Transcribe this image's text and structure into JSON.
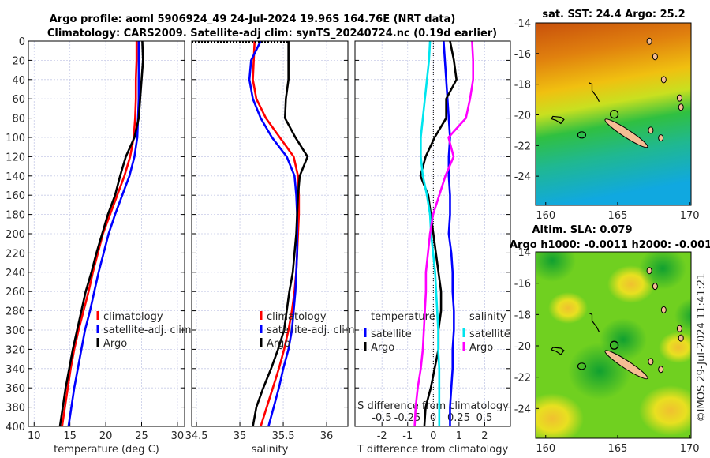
{
  "title_line1": "Argo profile: aoml 5906924_49 24-Jul-2024 19.96S 164.76E (NRT data)",
  "title_line2": "Climatology: CARS2009. Satellite-adj clim: synTS_20240724.nc (0.19d earlier)",
  "watermark": "©IMOS 29-Jul-2024 11:41:21",
  "colors": {
    "climatology": "#ff0000",
    "satellite": "#0000ff",
    "argo": "#000000",
    "sat_salinity": "#00e5ee",
    "argo_salinity": "#ff00ff",
    "land": "#f5bd94"
  },
  "chart_data": [
    {
      "type": "line",
      "xlabel": "temperature (deg C)",
      "ylabel": "",
      "xlim": [
        9.2,
        31.0
      ],
      "ylim": [
        400,
        0
      ],
      "xticks": [
        10,
        15,
        20,
        25,
        30
      ],
      "yticks": [
        0,
        20,
        40,
        60,
        80,
        100,
        120,
        140,
        160,
        180,
        200,
        220,
        240,
        260,
        280,
        300,
        320,
        340,
        360,
        380,
        400
      ],
      "grid": true,
      "legend": "center-right",
      "depth": [
        0,
        20,
        40,
        60,
        80,
        100,
        120,
        140,
        160,
        180,
        200,
        220,
        240,
        260,
        280,
        300,
        320,
        340,
        360,
        380,
        400
      ],
      "series": [
        {
          "name": "climatology",
          "color": "#ff0000",
          "values": [
            24.3,
            24.3,
            24.2,
            24.2,
            24.1,
            23.9,
            23.4,
            22.6,
            21.6,
            20.6,
            19.6,
            18.9,
            18.2,
            17.6,
            16.9,
            16.2,
            15.6,
            15.1,
            14.7,
            14.3,
            13.9
          ]
        },
        {
          "name": "satellite-adj. clim",
          "color": "#0000ff",
          "values": [
            24.6,
            24.6,
            24.6,
            24.6,
            24.5,
            24.4,
            24.0,
            23.3,
            22.3,
            21.3,
            20.4,
            19.7,
            19.0,
            18.4,
            17.8,
            17.1,
            16.6,
            16.1,
            15.6,
            15.2,
            14.8
          ]
        },
        {
          "name": "Argo",
          "color": "#000000",
          "values": [
            25.1,
            25.2,
            25.0,
            24.8,
            24.6,
            24.0,
            22.8,
            22.0,
            21.3,
            20.3,
            19.5,
            18.7,
            18.0,
            17.2,
            16.6,
            16.0,
            15.4,
            14.9,
            14.4,
            14.0,
            13.6
          ]
        }
      ]
    },
    {
      "type": "line",
      "xlabel": "salinity",
      "xlim": [
        34.445,
        36.245
      ],
      "ylim": [
        400,
        0
      ],
      "xticks": [
        34.5,
        35,
        35.5,
        36
      ],
      "grid": true,
      "legend": "center-right",
      "depth": [
        0,
        20,
        40,
        60,
        80,
        100,
        120,
        140,
        160,
        180,
        200,
        220,
        240,
        260,
        280,
        300,
        320,
        340,
        360,
        380,
        400
      ],
      "series": [
        {
          "name": "climatology",
          "color": "#ff0000",
          "values": [
            35.17,
            35.16,
            35.15,
            35.19,
            35.3,
            35.46,
            35.62,
            35.67,
            35.68,
            35.68,
            35.67,
            35.66,
            35.65,
            35.63,
            35.6,
            35.56,
            35.51,
            35.45,
            35.38,
            35.31,
            35.24
          ]
        },
        {
          "name": "satellite-adj. clim",
          "color": "#0000ff",
          "values": [
            35.24,
            35.13,
            35.11,
            35.15,
            35.24,
            35.37,
            35.54,
            35.63,
            35.65,
            35.66,
            35.66,
            35.66,
            35.65,
            35.64,
            35.62,
            35.6,
            35.56,
            35.5,
            35.45,
            35.39,
            35.33
          ]
        },
        {
          "name": "Argo",
          "color": "#000000",
          "values": [
            35.56,
            35.56,
            35.56,
            35.53,
            35.52,
            35.64,
            35.78,
            35.69,
            35.67,
            35.66,
            35.65,
            35.63,
            35.61,
            35.57,
            35.54,
            35.51,
            35.44,
            35.36,
            35.27,
            35.19,
            35.15
          ]
        }
      ]
    },
    {
      "type": "line",
      "xlabel": "T difference from climatology",
      "xlabel2": "S difference from climatology",
      "xlim": [
        -3.05,
        3.0
      ],
      "ylim": [
        400,
        0
      ],
      "xticks": [
        -2,
        -1,
        0,
        1,
        2
      ],
      "xlim_s": [
        -0.75,
        0.75
      ],
      "xticks_s": [
        "-0.5",
        "-0.25",
        "0",
        "0.25",
        "0.5"
      ],
      "grid": true,
      "legend_t_title": "temperature",
      "legend_s_title": "salinity",
      "depth": [
        0,
        20,
        40,
        60,
        80,
        100,
        120,
        140,
        160,
        180,
        200,
        220,
        240,
        260,
        280,
        300,
        320,
        340,
        360,
        380,
        400
      ],
      "series": [
        {
          "name": "satellite",
          "quantity": "temperature",
          "color": "#0000ff",
          "values": [
            0.4,
            0.45,
            0.5,
            0.55,
            0.6,
            0.65,
            0.6,
            0.6,
            0.65,
            0.65,
            0.6,
            0.7,
            0.75,
            0.75,
            0.8,
            0.8,
            0.75,
            0.75,
            0.7,
            0.65,
            0.65
          ]
        },
        {
          "name": "Argo",
          "quantity": "temperature",
          "color": "#000000",
          "values": [
            0.65,
            0.8,
            0.9,
            0.5,
            0.5,
            0.05,
            -0.3,
            -0.5,
            -0.2,
            -0.1,
            0.0,
            0.1,
            0.2,
            0.3,
            0.3,
            0.2,
            0.2,
            0.05,
            -0.1,
            -0.3,
            -0.35
          ]
        },
        {
          "name": "satellite",
          "quantity": "salinity",
          "color": "#00e5ee",
          "values": [
            -0.03,
            -0.04,
            -0.06,
            -0.08,
            -0.1,
            -0.12,
            -0.12,
            -0.1,
            -0.06,
            -0.03,
            -0.02,
            0.0,
            0.02,
            0.03,
            0.04,
            0.05,
            0.05,
            0.06,
            0.06,
            0.06,
            0.06
          ]
        },
        {
          "name": "Argo",
          "quantity": "salinity",
          "color": "#ff00ff",
          "values": [
            0.38,
            0.39,
            0.39,
            0.36,
            0.32,
            0.15,
            0.2,
            0.12,
            0.06,
            0.0,
            -0.03,
            -0.05,
            -0.07,
            -0.07,
            -0.08,
            -0.09,
            -0.1,
            -0.12,
            -0.15,
            -0.17,
            -0.18
          ]
        }
      ]
    },
    {
      "type": "heatmap",
      "title": "sat. SST: 24.4 Argo: 25.2",
      "xlim": [
        159.3,
        170.1
      ],
      "ylim": [
        -25.9,
        -14
      ],
      "xticks": [
        160,
        165,
        170
      ],
      "yticks": [
        -14,
        -16,
        -18,
        -20,
        -22,
        -24
      ],
      "marker": {
        "lon": 164.76,
        "lat": -19.96
      }
    },
    {
      "type": "heatmap",
      "title": "Altim. SLA: 0.079",
      "subtitle": "Argo h1000: -0.0011 h2000: -0.001",
      "xlim": [
        159.3,
        170.1
      ],
      "ylim": [
        -25.9,
        -14
      ],
      "xticks": [
        160,
        165,
        170
      ],
      "yticks": [
        -14,
        -16,
        -18,
        -20,
        -22,
        -24
      ],
      "marker": {
        "lon": 164.76,
        "lat": -19.96
      }
    }
  ]
}
